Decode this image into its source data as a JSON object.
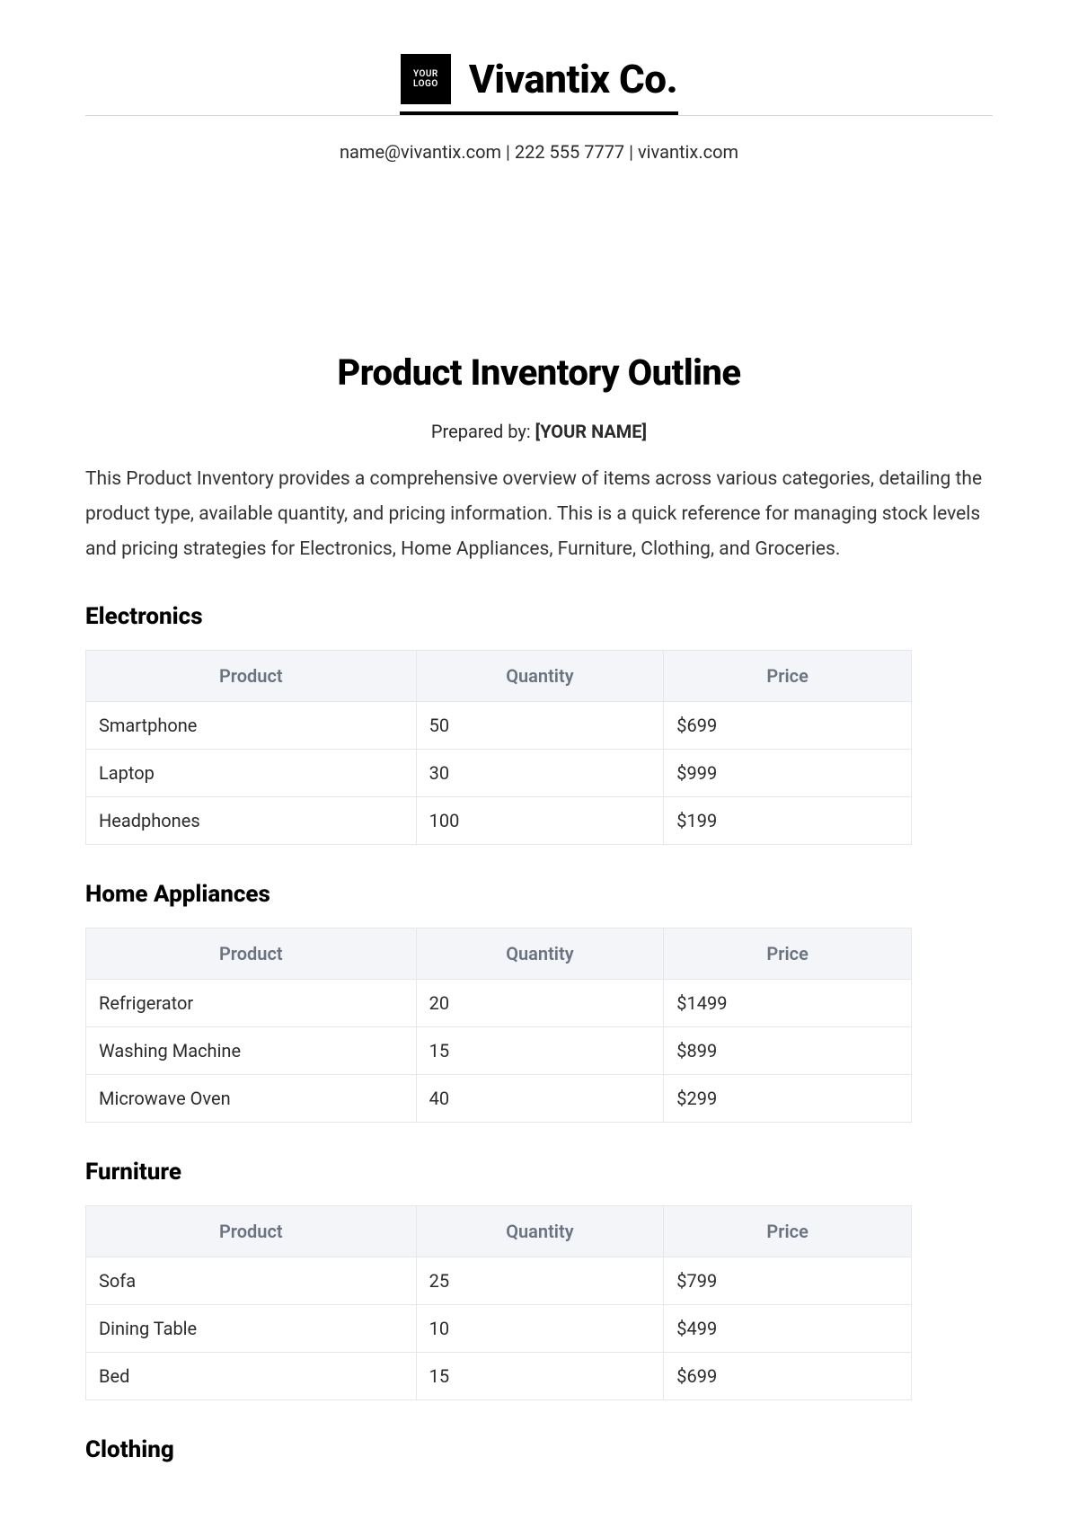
{
  "header": {
    "logo_line1": "YOUR",
    "logo_line2": "LOGO",
    "company_name": "Vivantix Co.",
    "contact": "name@vivantix.com | 222 555 7777 | vivantix.com"
  },
  "document": {
    "title": "Product Inventory Outline",
    "prepared_by_label": "Prepared by: ",
    "prepared_by_name": "[YOUR NAME]",
    "intro": "This Product Inventory provides a comprehensive overview of items across various categories, detailing the product type, available quantity, and pricing information. This is a quick reference for managing stock levels and pricing strategies for Electronics, Home Appliances, Furniture, Clothing, and Groceries."
  },
  "columns": {
    "product": "Product",
    "quantity": "Quantity",
    "price": "Price"
  },
  "sections": [
    {
      "title": "Electronics",
      "rows": [
        {
          "product": "Smartphone",
          "quantity": "50",
          "price": "$699"
        },
        {
          "product": "Laptop",
          "quantity": "30",
          "price": "$999"
        },
        {
          "product": "Headphones",
          "quantity": "100",
          "price": "$199"
        }
      ]
    },
    {
      "title": "Home Appliances",
      "rows": [
        {
          "product": "Refrigerator",
          "quantity": "20",
          "price": "$1499"
        },
        {
          "product": "Washing Machine",
          "quantity": "15",
          "price": "$899"
        },
        {
          "product": "Microwave Oven",
          "quantity": "40",
          "price": "$299"
        }
      ]
    },
    {
      "title": "Furniture",
      "rows": [
        {
          "product": "Sofa",
          "quantity": "25",
          "price": "$799"
        },
        {
          "product": "Dining Table",
          "quantity": "10",
          "price": "$499"
        },
        {
          "product": "Bed",
          "quantity": "15",
          "price": "$699"
        }
      ]
    },
    {
      "title": "Clothing",
      "rows": []
    }
  ]
}
